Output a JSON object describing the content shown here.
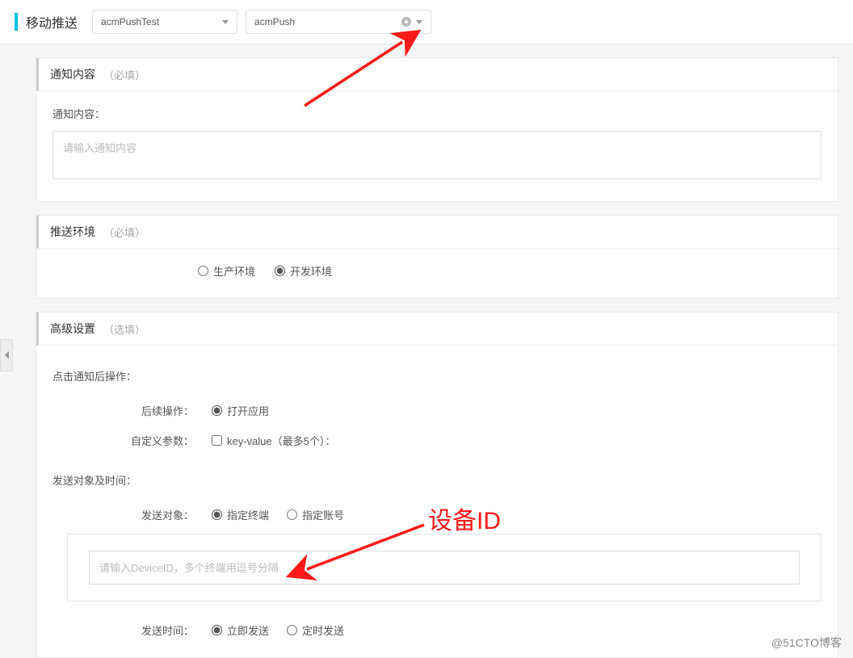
{
  "header": {
    "title": "移动推送",
    "select1": "acmPushTest",
    "select2": "acmPush"
  },
  "panels": {
    "notify": {
      "title": "通知内容",
      "hint": "（必填）",
      "content_label": "通知内容：",
      "content_placeholder": "请输入通知内容"
    },
    "env": {
      "title": "推送环境",
      "hint": "（必填）",
      "options": {
        "prod": "生产环境",
        "dev": "开发环境"
      }
    },
    "advanced": {
      "title": "高级设置",
      "hint": "（选填）",
      "after_click_label": "点击通知后操作：",
      "followup_label": "后续操作：",
      "followup_option": "打开应用",
      "custom_params_label": "自定义参数：",
      "custom_params_option": "key-value（最多5个）：",
      "target_time_label": "发送对象及时间：",
      "target_label": "发送对象：",
      "target_options": {
        "device": "指定终端",
        "account": "指定账号"
      },
      "device_placeholder": "请输入DeviceID，多个终端用逗号分隔",
      "send_time_label": "发送时间：",
      "send_time_options": {
        "now": "立即发送",
        "scheduled": "定时发送"
      }
    }
  },
  "annotations": {
    "device_id_label": "设备ID"
  },
  "watermark": "@51CTO博客"
}
